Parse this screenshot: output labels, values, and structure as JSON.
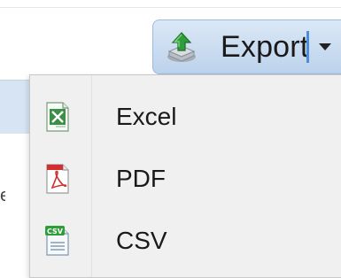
{
  "toolbar": {
    "export_label": "Export"
  },
  "menu": {
    "items": [
      {
        "label": "Excel",
        "icon": "excel-file-icon"
      },
      {
        "label": "PDF",
        "icon": "pdf-file-icon"
      },
      {
        "label": "CSV",
        "icon": "csv-file-icon"
      }
    ]
  },
  "icons": {
    "csv_badge": "CSV"
  },
  "colors": {
    "button_gradient_top": "#dbe8f6",
    "button_gradient_bottom": "#bcd2eb",
    "separator": "#4a90d9",
    "menu_background": "#f0f0f0"
  }
}
